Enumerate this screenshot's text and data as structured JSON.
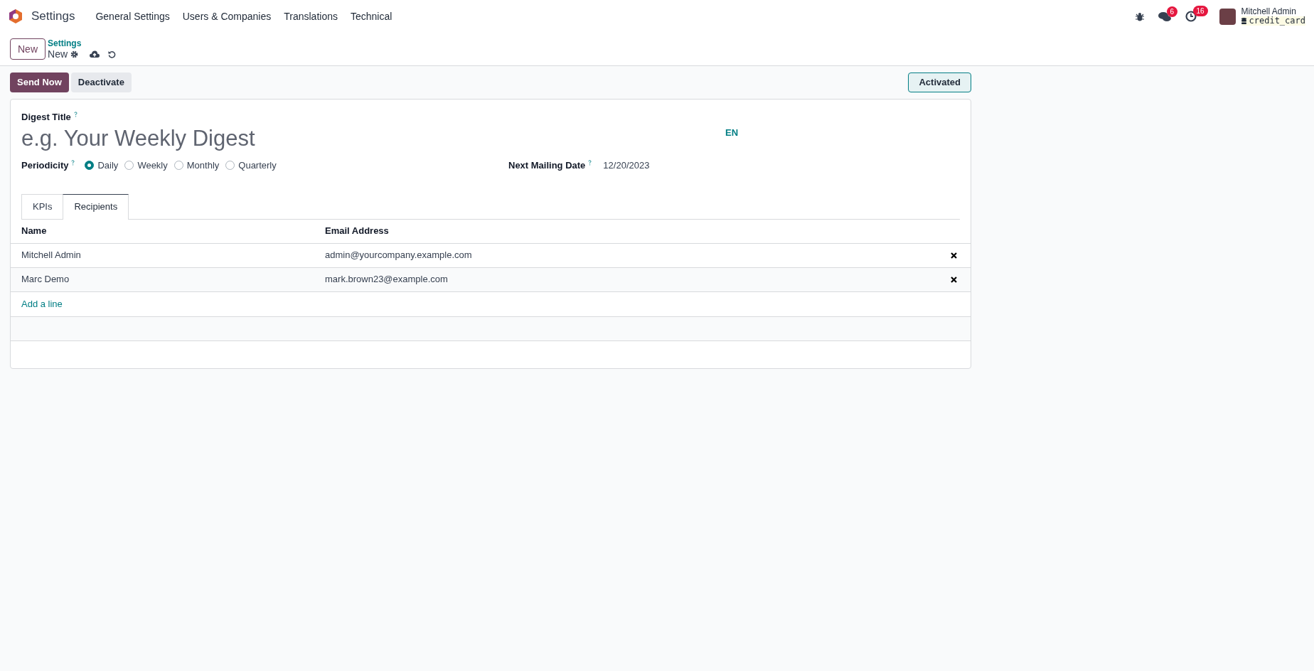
{
  "navbar": {
    "app": "Settings",
    "menus": [
      "General Settings",
      "Users & Companies",
      "Translations",
      "Technical"
    ],
    "messages_count": "6",
    "activities_count": "16",
    "user": "Mitchell Admin",
    "database": "credit_card"
  },
  "control_panel": {
    "new_button": "New",
    "breadcrumb": "Settings",
    "record": "New"
  },
  "actions": {
    "send_now": "Send Now",
    "deactivate": "Deactivate",
    "status": "Activated"
  },
  "form": {
    "title_label": "Digest Title",
    "title_placeholder": "e.g. Your Weekly Digest",
    "lang": "EN",
    "periodicity_label": "Periodicity",
    "periodicity": [
      {
        "label": "Daily",
        "selected": true
      },
      {
        "label": "Weekly",
        "selected": false
      },
      {
        "label": "Monthly",
        "selected": false
      },
      {
        "label": "Quarterly",
        "selected": false
      }
    ],
    "next_mailing_label": "Next Mailing Date",
    "next_mailing": "12/20/2023"
  },
  "tabs": [
    {
      "label": "KPIs",
      "selected": false
    },
    {
      "label": "Recipients",
      "selected": true
    }
  ],
  "table": {
    "columns": [
      "Name",
      "Email Address"
    ],
    "rows": [
      {
        "name": "Mitchell Admin",
        "email": "admin@yourcompany.example.com"
      },
      {
        "name": "Marc Demo",
        "email": "mark.brown23@example.com"
      }
    ],
    "add_line": "Add a line"
  }
}
